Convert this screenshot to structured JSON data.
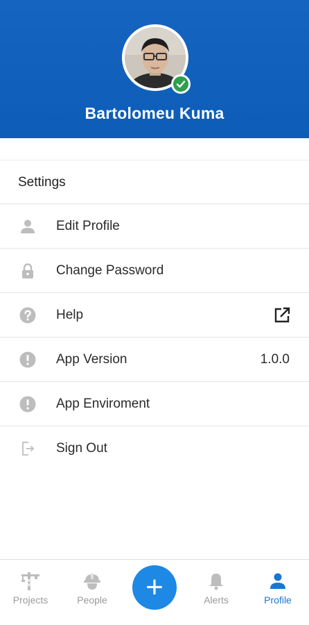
{
  "profile": {
    "user_name": "Bartolomeu  Kuma",
    "verified": true
  },
  "settings": {
    "title": "Settings",
    "items": [
      {
        "label": "Edit Profile",
        "icon": "person-icon"
      },
      {
        "label": "Change Password",
        "icon": "lock-icon"
      },
      {
        "label": "Help",
        "icon": "question-icon",
        "trailing_icon": "external-link-icon"
      },
      {
        "label": "App Version",
        "icon": "exclamation-icon",
        "value": "1.0.0"
      },
      {
        "label": "App Enviroment",
        "icon": "exclamation-icon"
      },
      {
        "label": "Sign Out",
        "icon": "sign-out-icon"
      }
    ]
  },
  "tabbar": {
    "tabs": [
      {
        "label": "Projects",
        "icon": "crane-icon"
      },
      {
        "label": "People",
        "icon": "hardhat-icon"
      },
      {
        "label": "Alerts",
        "icon": "bell-icon"
      },
      {
        "label": "Profile",
        "icon": "person-icon",
        "active": true
      }
    ],
    "fab_label": "+"
  },
  "colors": {
    "header_blue": "#1565C0",
    "accent_blue": "#1E88E5",
    "verified_green": "#2E9E4F",
    "icon_gray": "#BDBDBD"
  }
}
